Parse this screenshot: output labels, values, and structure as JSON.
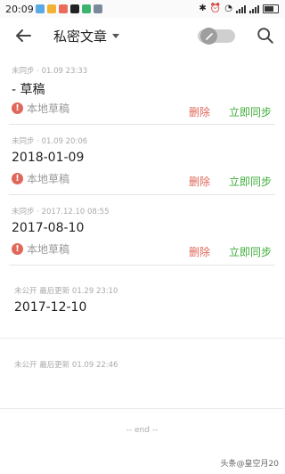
{
  "status_bar": {
    "time": "20:09"
  },
  "app_bar": {
    "title": "私密文章"
  },
  "items": [
    {
      "meta": "未同步 · 01.09 23:33",
      "title": "- 草稿",
      "local_label": "本地草稿",
      "delete_label": "删除",
      "sync_label": "立即同步"
    },
    {
      "meta": "未同步 · 01.09 20:06",
      "title": "2018-01-09",
      "local_label": "本地草稿",
      "delete_label": "删除",
      "sync_label": "立即同步"
    },
    {
      "meta": "未同步 · 2017.12.10 08:55",
      "title": "2017-08-10",
      "local_label": "本地草稿",
      "delete_label": "删除",
      "sync_label": "立即同步"
    },
    {
      "meta": "未公开  最后更新  01.29 23:10",
      "title": "2017-12-10"
    },
    {
      "meta": "未公开  最后更新  01.09 22:46",
      "title": ""
    }
  ],
  "footer": {
    "end_text": "-- end --",
    "watermark": "头条@皇空月20"
  },
  "colors": {
    "delete": "#e0675a",
    "sync": "#3fae3b",
    "warning": "#e0675a"
  },
  "icons": [
    "back-arrow-icon",
    "caret-down-icon",
    "pencil-icon",
    "search-icon",
    "warning-icon"
  ]
}
